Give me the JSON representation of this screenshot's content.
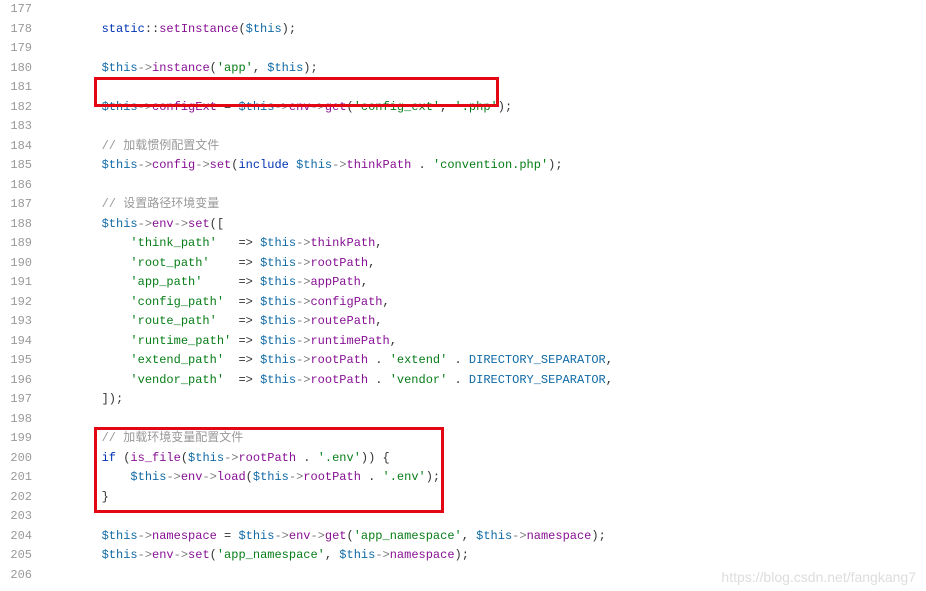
{
  "gutter": [
    "177",
    "178",
    "179",
    "180",
    "181",
    "182",
    "183",
    "184",
    "185",
    "186",
    "187",
    "188",
    "189",
    "190",
    "191",
    "192",
    "193",
    "194",
    "195",
    "196",
    "197",
    "198",
    "199",
    "200",
    "201",
    "202",
    "203",
    "204",
    "205",
    "206"
  ],
  "code": {
    "l177": "",
    "l178": {
      "p": "        ",
      "a": "static",
      "b": "::",
      "c": "setInstance",
      "d": "(",
      "e": "$this",
      "f": ");"
    },
    "l179": "",
    "l180": {
      "p": "        ",
      "a": "$this",
      "b": "->",
      "c": "instance",
      "d": "(",
      "e": "'app'",
      "f": ", ",
      "g": "$this",
      "h": ");"
    },
    "l181": "",
    "l182": {
      "p": "        ",
      "a": "$this",
      "b": "->",
      "c": "configExt",
      "d": " = ",
      "e": "$this",
      "f": "->",
      "g": "env",
      "h": "->",
      "i": "get",
      "j": "(",
      "k": "'config_ext'",
      "l": ", ",
      "m": "'.php'",
      "n": ");"
    },
    "l183": "",
    "l184": {
      "p": "        ",
      "a": "// 加载惯例配置文件"
    },
    "l185": {
      "p": "        ",
      "a": "$this",
      "b": "->",
      "c": "config",
      "d": "->",
      "e": "set",
      "f": "(",
      "g": "include",
      "h": " ",
      "i": "$this",
      "j": "->",
      "k": "thinkPath",
      "l": " . ",
      "m": "'convention.php'",
      "n": ");"
    },
    "l186": "",
    "l187": {
      "p": "        ",
      "a": "// 设置路径环境变量"
    },
    "l188": {
      "p": "        ",
      "a": "$this",
      "b": "->",
      "c": "env",
      "d": "->",
      "e": "set",
      "f": "(["
    },
    "l189": {
      "p": "            ",
      "a": "'think_path'",
      "b": "   => ",
      "c": "$this",
      "d": "->",
      "e": "thinkPath",
      "f": ","
    },
    "l190": {
      "p": "            ",
      "a": "'root_path'",
      "b": "    => ",
      "c": "$this",
      "d": "->",
      "e": "rootPath",
      "f": ","
    },
    "l191": {
      "p": "            ",
      "a": "'app_path'",
      "b": "     => ",
      "c": "$this",
      "d": "->",
      "e": "appPath",
      "f": ","
    },
    "l192": {
      "p": "            ",
      "a": "'config_path'",
      "b": "  => ",
      "c": "$this",
      "d": "->",
      "e": "configPath",
      "f": ","
    },
    "l193": {
      "p": "            ",
      "a": "'route_path'",
      "b": "   => ",
      "c": "$this",
      "d": "->",
      "e": "routePath",
      "f": ","
    },
    "l194": {
      "p": "            ",
      "a": "'runtime_path'",
      "b": " => ",
      "c": "$this",
      "d": "->",
      "e": "runtimePath",
      "f": ","
    },
    "l195": {
      "p": "            ",
      "a": "'extend_path'",
      "b": "  => ",
      "c": "$this",
      "d": "->",
      "e": "rootPath",
      "f": " . ",
      "g": "'extend'",
      "h": " . ",
      "i": "DIRECTORY_SEPARATOR",
      "j": ","
    },
    "l196": {
      "p": "            ",
      "a": "'vendor_path'",
      "b": "  => ",
      "c": "$this",
      "d": "->",
      "e": "rootPath",
      "f": " . ",
      "g": "'vendor'",
      "h": " . ",
      "i": "DIRECTORY_SEPARATOR",
      "j": ","
    },
    "l197": {
      "p": "        ",
      "a": "]);"
    },
    "l198": "",
    "l199": {
      "p": "        ",
      "a": "// 加载环境变量配置文件"
    },
    "l200": {
      "p": "        ",
      "a": "if",
      "b": " (",
      "c": "is_file",
      "d": "(",
      "e": "$this",
      "f": "->",
      "g": "rootPath",
      "h": " . ",
      "i": "'.env'",
      "j": ")) {"
    },
    "l201": {
      "p": "            ",
      "a": "$this",
      "b": "->",
      "c": "env",
      "d": "->",
      "e": "load",
      "f": "(",
      "g": "$this",
      "h": "->",
      "i": "rootPath",
      "j": " . ",
      "k": "'.env'",
      "l": ");"
    },
    "l202": {
      "p": "        ",
      "a": "}"
    },
    "l203": "",
    "l204": {
      "p": "        ",
      "a": "$this",
      "b": "->",
      "c": "namespace",
      "d": " = ",
      "e": "$this",
      "f": "->",
      "g": "env",
      "h": "->",
      "i": "get",
      "j": "(",
      "k": "'app_namespace'",
      "l": ", ",
      "m": "$this",
      "n": "->",
      "o": "namespace",
      "p2": ");"
    },
    "l205": {
      "p": "        ",
      "a": "$this",
      "b": "->",
      "c": "env",
      "d": "->",
      "e": "set",
      "f": "(",
      "g": "'app_namespace'",
      "h": ", ",
      "i": "$this",
      "j": "->",
      "k": "namespace",
      "l": ");"
    }
  },
  "watermark": "https://blog.csdn.net/fangkang7"
}
